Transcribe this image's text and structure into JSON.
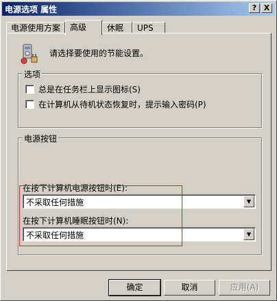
{
  "window": {
    "title": "电源选项 属性",
    "help_label": "?",
    "close_label": "X"
  },
  "tabs": [
    {
      "label": "电源使用方案"
    },
    {
      "label": "高级",
      "active": true
    },
    {
      "label": "休眠"
    },
    {
      "label": "UPS"
    }
  ],
  "intro": {
    "text": "请选择要使用的节能设置。",
    "icon": "power-settings-icon"
  },
  "options_group": {
    "title": "选项",
    "items": [
      {
        "label": "总是在任务栏上显示图标(S)",
        "checked": false
      },
      {
        "label": "在计算机从待机状态恢复时，提示输入密码(P)",
        "checked": false
      }
    ]
  },
  "power_buttons_group": {
    "title": "电源按钮",
    "power_button_label": "在按下计算机电源按钮时(E):",
    "power_button_value": "不采取任何措施",
    "sleep_button_label": "在按下计算机睡眠按钮时(N):",
    "sleep_button_value": "不采取任何措施"
  },
  "buttons": {
    "ok": "确定",
    "cancel": "取消",
    "apply": "应用(A)"
  },
  "colors": {
    "titlebar_start": "#0a246a",
    "titlebar_end": "#a6caf0",
    "face": "#d4d0c8",
    "annotation": "#e02020"
  }
}
